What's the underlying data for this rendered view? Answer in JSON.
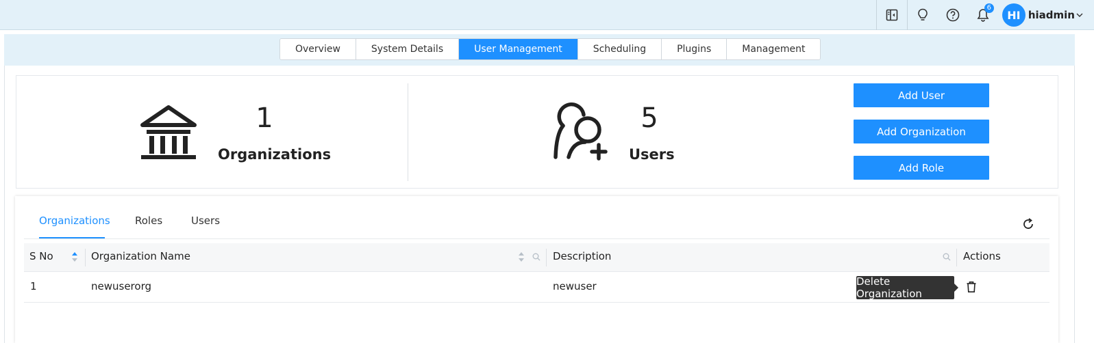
{
  "header": {
    "notification_count": "6",
    "user_initials": "HI",
    "user_name": "hiadmin"
  },
  "main_tabs": [
    {
      "label": "Overview"
    },
    {
      "label": "System Details"
    },
    {
      "label": "User Management"
    },
    {
      "label": "Scheduling"
    },
    {
      "label": "Plugins"
    },
    {
      "label": "Management"
    }
  ],
  "stats": {
    "organizations": {
      "count": "1",
      "label": "Organizations"
    },
    "users": {
      "count": "5",
      "label": "Users"
    }
  },
  "actions": {
    "add_user": "Add User",
    "add_organization": "Add Organization",
    "add_role": "Add Role"
  },
  "sub_tabs": [
    {
      "label": "Organizations"
    },
    {
      "label": "Roles"
    },
    {
      "label": "Users"
    }
  ],
  "table": {
    "columns": [
      "S No",
      "Organization Name",
      "Description",
      "Actions"
    ],
    "rows": [
      {
        "sno": "1",
        "name": "newuserorg",
        "description": "newuser"
      }
    ]
  },
  "tooltip": "Delete Organization",
  "colors": {
    "accent": "#1e90ff",
    "topbar_bg": "#e3f1f9",
    "tooltip_bg": "#333333"
  },
  "icons": [
    "panel-icon",
    "lightbulb-icon",
    "help-icon",
    "bell-icon",
    "chevron-down-icon",
    "bank-icon",
    "add-user-icon",
    "refresh-icon",
    "sort-icon",
    "search-icon",
    "trash-icon"
  ]
}
